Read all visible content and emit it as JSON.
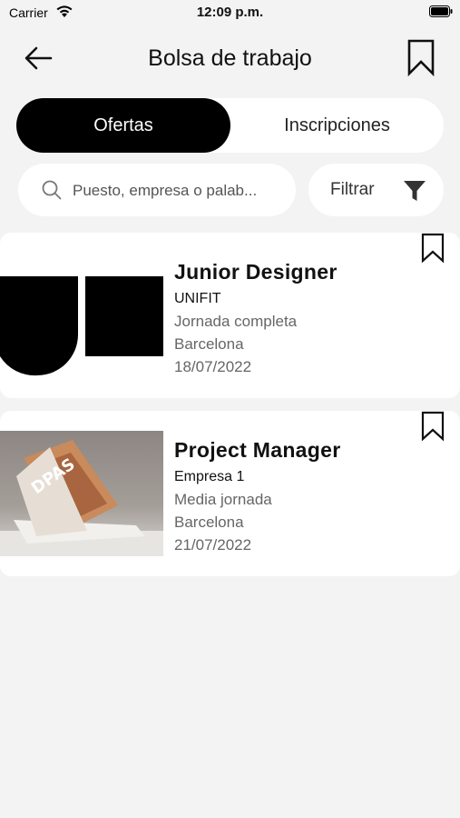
{
  "status_bar": {
    "carrier": "Carrier",
    "time": "12:09 p.m.",
    "icons": [
      "wifi-icon",
      "battery-icon"
    ]
  },
  "header": {
    "title": "Bolsa de trabajo",
    "back_icon": "arrow-left-icon",
    "bookmark_icon": "bookmark-icon"
  },
  "tabs": [
    {
      "label": "Ofertas",
      "active": true
    },
    {
      "label": "Inscripciones",
      "active": false
    }
  ],
  "search": {
    "placeholder": "Puesto, empresa o palab...",
    "value": "",
    "icon": "search-icon"
  },
  "filter": {
    "label": "Filtrar",
    "icon": "funnel-icon"
  },
  "jobs": [
    {
      "title": "Junior Designer",
      "company": "UNIFIT",
      "schedule": "Jornada completa",
      "location": "Barcelona",
      "date": "18/07/2022",
      "image": "unifit-logo",
      "bookmarked": false
    },
    {
      "title": "Project Manager",
      "company": "Empresa 1",
      "schedule": "Media jornada",
      "location": "Barcelona",
      "date": "21/07/2022",
      "image": "magazine-photo",
      "bookmarked": false
    }
  ],
  "colors": {
    "background": "#f3f3f3",
    "active_tab": "#000000",
    "card": "#ffffff",
    "meta_text": "#666666"
  }
}
